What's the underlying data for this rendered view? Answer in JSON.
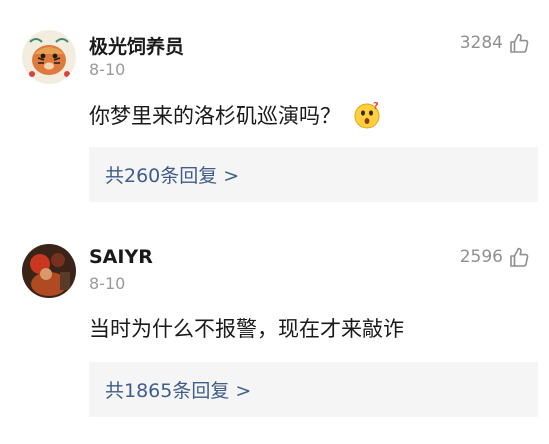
{
  "comments": [
    {
      "username": "极光饲养员",
      "date": "8-10",
      "likes": "3284",
      "text": "你梦里来的洛杉矶巡演吗？",
      "emoji": "surprised-face-emoji",
      "replies_label": "共260条回复 >"
    },
    {
      "username": "SAIYR",
      "date": "8-10",
      "likes": "2596",
      "text": "当时为什么不报警，现在才来敲诈",
      "replies_label": "共1865条回复 >"
    }
  ],
  "colors": {
    "link": "#3f5d8a",
    "muted": "#9a9a9a",
    "reply_bg": "#f5f5f5"
  }
}
